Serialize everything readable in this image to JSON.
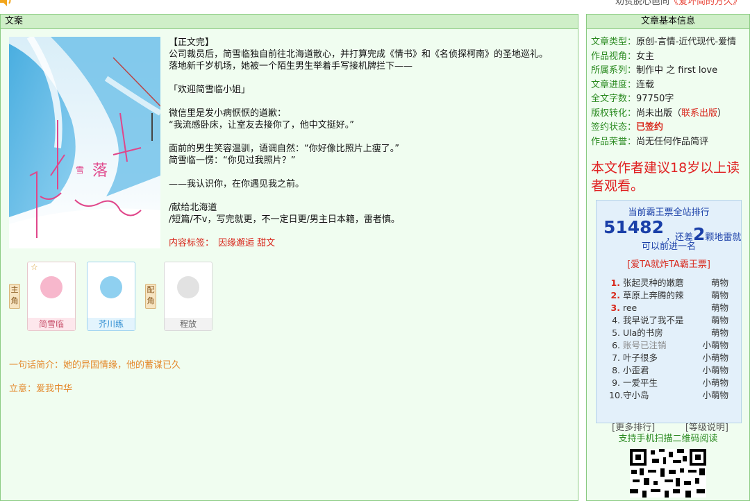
{
  "top": {
    "promo_prefix": "劝贫脱心邑同",
    "promo_highlight": "《爱坏简的方久》"
  },
  "left_panel": {
    "title": "文案",
    "synopsis": [
      "【正文完】",
      "公司裁员后，简雪临独自前往北海道散心，并打算完成《情书》和《名侦探柯南》的圣地巡礼。",
      "落地新千岁机场，她被一个陌生男生举着手写接机牌拦下——",
      "",
      "「欢迎简雪临小姐」",
      "",
      "微信里是发小病恹恹的道歉：",
      "“我流感卧床，让室友去接你了，他中文挺好。”",
      "",
      "面前的男生笑容温驯，语调自然：“你好像比照片上瘦了。”",
      "简雪临一愣：“你见过我照片？”",
      "",
      "——我认识你，在你遇见我之前。",
      "",
      "/献给北海道",
      "/短篇/不v，写完就更，不一定日更/男主日本籍，雷者慎。"
    ],
    "tags_label": "内容标签：",
    "tags": "因缘邂逅 甜文",
    "role_main": "主角",
    "role_support": "配角",
    "characters": [
      {
        "name": "简雪临"
      },
      {
        "name": "芥川练"
      },
      {
        "name": "程放"
      }
    ],
    "one_line": "一句话简介：她的异国情缘，他的蓄谋已久",
    "theme": "立意：爱我中华"
  },
  "right_panel": {
    "title": "文章基本信息",
    "info": [
      {
        "key": "文章类型：",
        "value": "原创-言情-近代现代-爱情"
      },
      {
        "key": "作品视角：",
        "value": "女主"
      },
      {
        "key": "所属系列：",
        "value": "制作中 之 first love"
      },
      {
        "key": "文章进度：",
        "value": "连载"
      },
      {
        "key": "全文字数：",
        "value": "97750字"
      },
      {
        "key": "版权转化：",
        "value": "尚未出版（",
        "link": "联系出版",
        "tail": "）"
      },
      {
        "key": "签约状态：",
        "signed": "已签约"
      },
      {
        "key": "作品荣誉：",
        "value": "尚无任何作品简评"
      }
    ],
    "age_notice": "本文作者建议18岁以上读者观看。",
    "rank": {
      "title": "当前霸王票全站排行",
      "number": "51482",
      "rest_a": "，还差",
      "rest_num": "2",
      "rest_b": "颗地雷就",
      "more": "可以前进一名",
      "bomb_link": "[爱TA就炸TA霸王票]",
      "fans": [
        {
          "n": "1.",
          "name": "张起灵种的嫩蘑",
          "level": "萌物"
        },
        {
          "n": "2.",
          "name": "草原上奔腾的辣",
          "level": "萌物"
        },
        {
          "n": "3.",
          "name": "ree",
          "level": "萌物"
        },
        {
          "n": "4.",
          "name": "我早说了我不是",
          "level": "萌物"
        },
        {
          "n": "5.",
          "name": "Ula的书房",
          "level": "萌物"
        },
        {
          "n": "6.",
          "name": "账号已注销",
          "level": "小萌物"
        },
        {
          "n": "7.",
          "name": "叶子很多",
          "level": "小萌物"
        },
        {
          "n": "8.",
          "name": "小歪君",
          "level": "小萌物"
        },
        {
          "n": "9.",
          "name": "一爱平生",
          "level": "小萌物"
        },
        {
          "n": "10.",
          "name": "守小岛",
          "level": "小萌物"
        }
      ],
      "more_rank": "[更多排行]",
      "level_info": "[等级说明]"
    },
    "qr_label": "支持手机扫描二维码阅读"
  },
  "colors": {
    "panel_bg": "#f0fdf0",
    "panel_head": "#cfefc8",
    "panel_border": "#8bcb82",
    "info_key": "#2a8a20",
    "accent_red": "#d8281c",
    "rank_blue": "#1a3fa8"
  }
}
